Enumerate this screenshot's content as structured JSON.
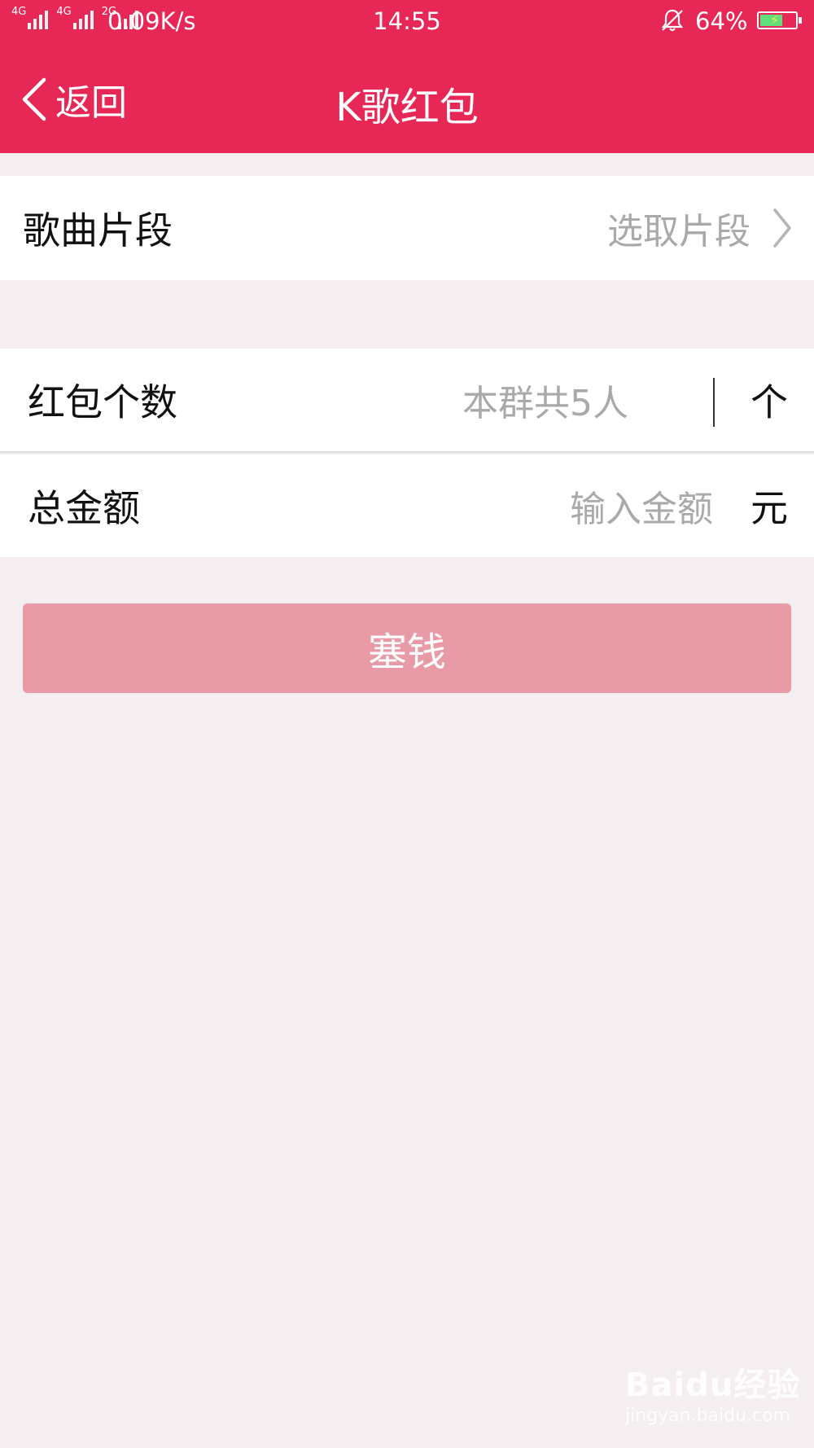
{
  "status_bar": {
    "sim1_label": "4G",
    "sim2_label": "4G",
    "sim3_label": "2G",
    "net_speed": "0.09K/s",
    "time": "14:55",
    "battery_pct": "64%",
    "battery_level": 0.64,
    "icons": [
      "signal-icon",
      "alarm-bell-icon",
      "battery-icon"
    ]
  },
  "header": {
    "back_label": "返回",
    "title": "K歌红包"
  },
  "song_row": {
    "label": "歌曲片段",
    "value": "选取片段"
  },
  "count_row": {
    "label": "红包个数",
    "placeholder": "本群共5人",
    "unit": "个"
  },
  "amount_row": {
    "label": "总金额",
    "placeholder": "输入金额",
    "unit": "元"
  },
  "submit_button": {
    "label": "塞钱"
  },
  "watermark": {
    "brand": "Baidu经验",
    "url": "jingyan.baidu.com"
  },
  "colors": {
    "accent": "#e72756",
    "button_disabled": "#e89ba6",
    "background": "#f4eef1"
  }
}
